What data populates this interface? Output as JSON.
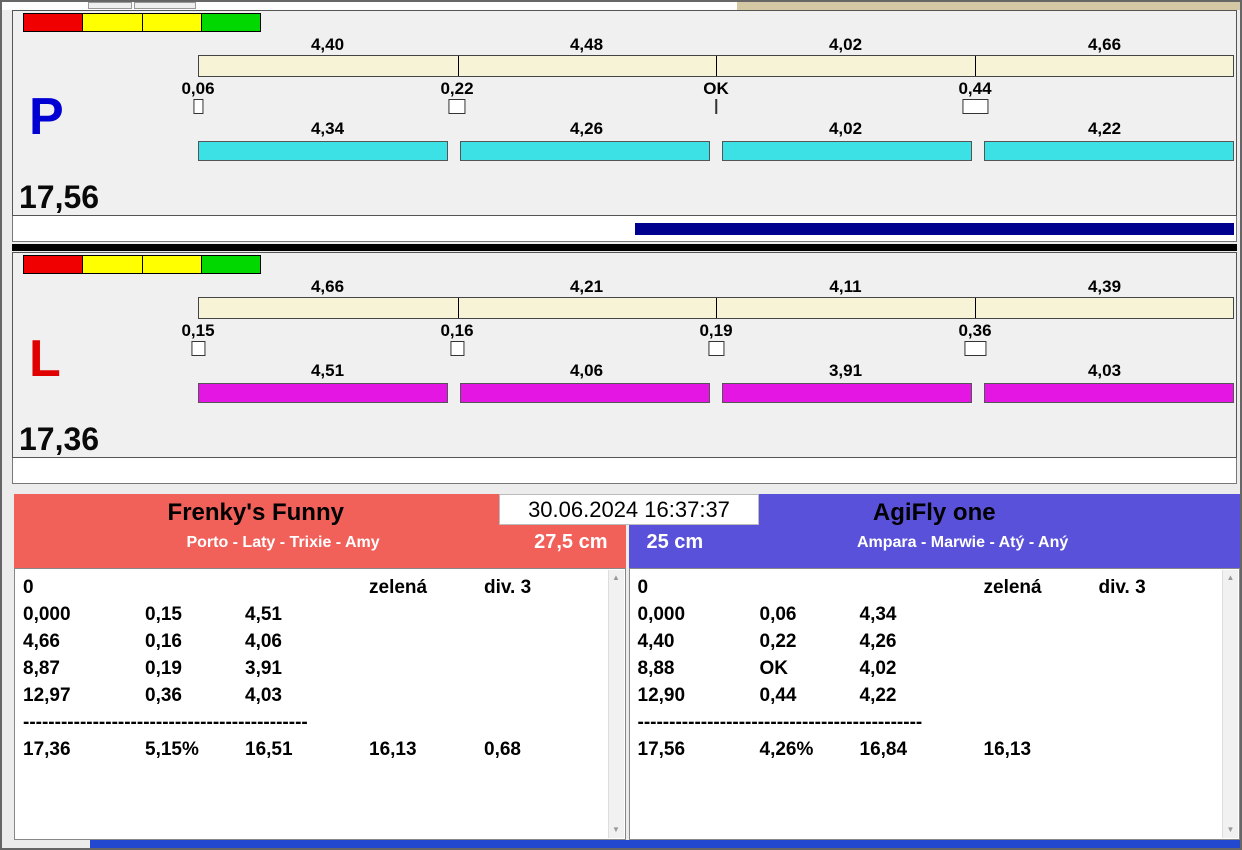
{
  "panels": [
    {
      "letter": "P",
      "letter_color": "#0000d2",
      "total": "17,56",
      "segment_times": [
        "4,40",
        "4,48",
        "4,02",
        "4,66"
      ],
      "gates": [
        "0,06",
        "0,22",
        "OK",
        "0,44"
      ],
      "lap_times": [
        "4,34",
        "4,26",
        "4,02",
        "4,22"
      ],
      "bar_color": "#3ce1e6",
      "progress": 0.49
    },
    {
      "letter": "L",
      "letter_color": "#e00000",
      "total": "17,36",
      "segment_times": [
        "4,66",
        "4,21",
        "4,11",
        "4,39"
      ],
      "gates": [
        "0,15",
        "0,16",
        "0,19",
        "0,36"
      ],
      "lap_times": [
        "4,51",
        "4,06",
        "3,91",
        "4,03"
      ],
      "bar_color": "#e316e3",
      "progress": 0
    }
  ],
  "timestamp": "30.06.2024 16:37:37",
  "teams": [
    {
      "name": "Frenky's Funny",
      "members": "Porto - Laty - Trixie - Amy",
      "height": "27,5 cm",
      "header_color": "#f2605a",
      "info_row": {
        "c1": "0",
        "c4": "zelená",
        "c5": "div. 3"
      },
      "rows": [
        [
          "0,000",
          "0,15",
          "4,51"
        ],
        [
          "4,66",
          "0,16",
          "4,06"
        ],
        [
          "8,87",
          "0,19",
          "3,91"
        ],
        [
          "12,97",
          "0,36",
          "4,03"
        ]
      ],
      "separator": "---------------------------------------------",
      "totals": [
        "17,36",
        "5,15%",
        "16,51",
        "16,13",
        "0,68"
      ]
    },
    {
      "name": "AgiFly one",
      "members": "Ampara - Marwie - Atý - Aný",
      "height": "25 cm",
      "header_color": "#5951da",
      "info_row": {
        "c1": "0",
        "c4": "zelená",
        "c5": "div. 3"
      },
      "rows": [
        [
          "0,000",
          "0,06",
          "4,34"
        ],
        [
          "4,40",
          "0,22",
          "4,26"
        ],
        [
          "8,88",
          "OK",
          "4,02"
        ],
        [
          "12,90",
          "0,44",
          "4,22"
        ]
      ],
      "separator": "---------------------------------------------",
      "totals": [
        "17,56",
        "4,26%",
        "16,84",
        "16,13",
        ""
      ]
    }
  ]
}
